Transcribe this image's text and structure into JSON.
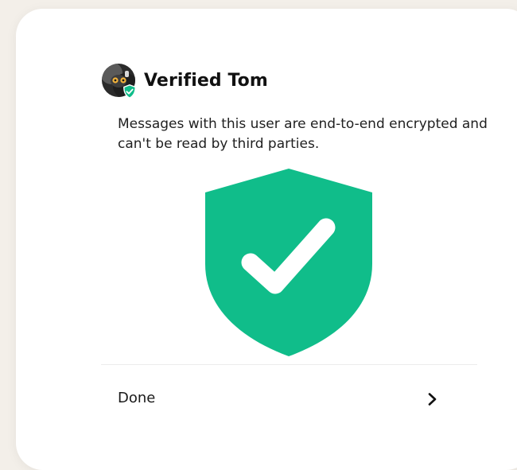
{
  "dialog": {
    "title": "Verified Tom",
    "message": "Messages with this user are end-to-end encrypted and can't be read by third parties.",
    "done_label": "Done"
  },
  "icons": {
    "avatar": "user-avatar",
    "badge": "verified-check-icon",
    "shield": "shield-check-icon",
    "chevron": "chevron-right-icon"
  },
  "colors": {
    "accent": "#10bd8a",
    "background": "#f3efe9",
    "card": "#ffffff"
  }
}
